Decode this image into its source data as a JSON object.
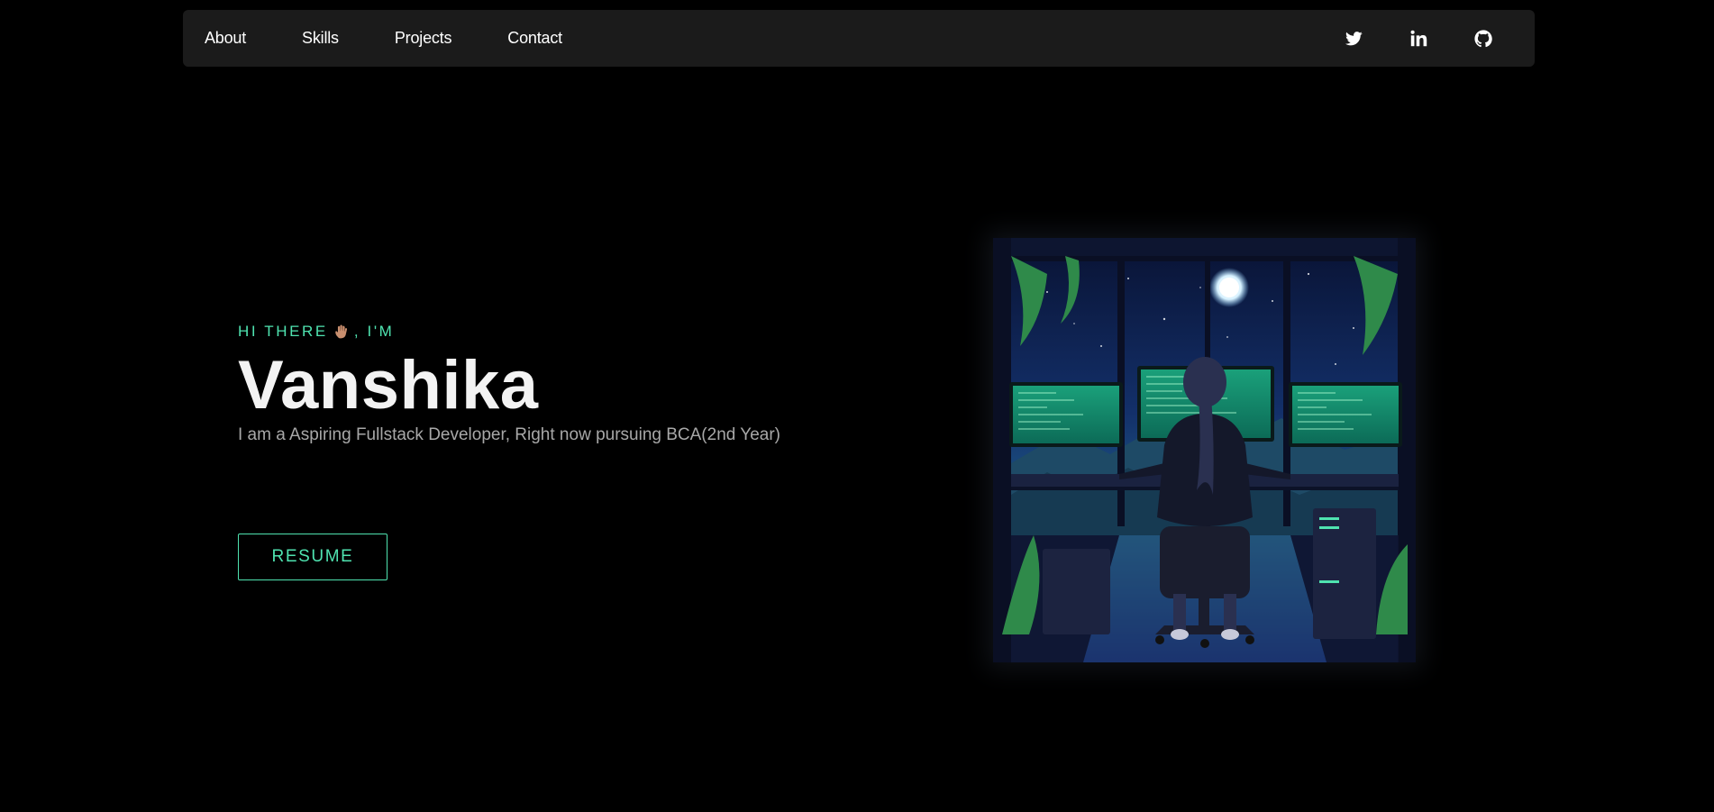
{
  "nav": {
    "links": [
      {
        "label": "About"
      },
      {
        "label": "Skills"
      },
      {
        "label": "Projects"
      },
      {
        "label": "Contact"
      }
    ],
    "social": [
      {
        "icon": "twitter-icon"
      },
      {
        "icon": "linkedin-icon"
      },
      {
        "icon": "github-icon"
      }
    ]
  },
  "hero": {
    "greeting_prefix": "HI THERE",
    "greeting_suffix": ", I'M",
    "name": "Vanshika",
    "tagline": "I am a Aspiring Fullstack Developer, Right now pursuing BCA(2nd Year)",
    "resume_label": "RESUME"
  },
  "colors": {
    "accent": "#4fe3b0",
    "background": "#000000",
    "navbar": "#1b1b1b",
    "name": "#f3f3f3",
    "tagline": "#a8a8a8"
  }
}
